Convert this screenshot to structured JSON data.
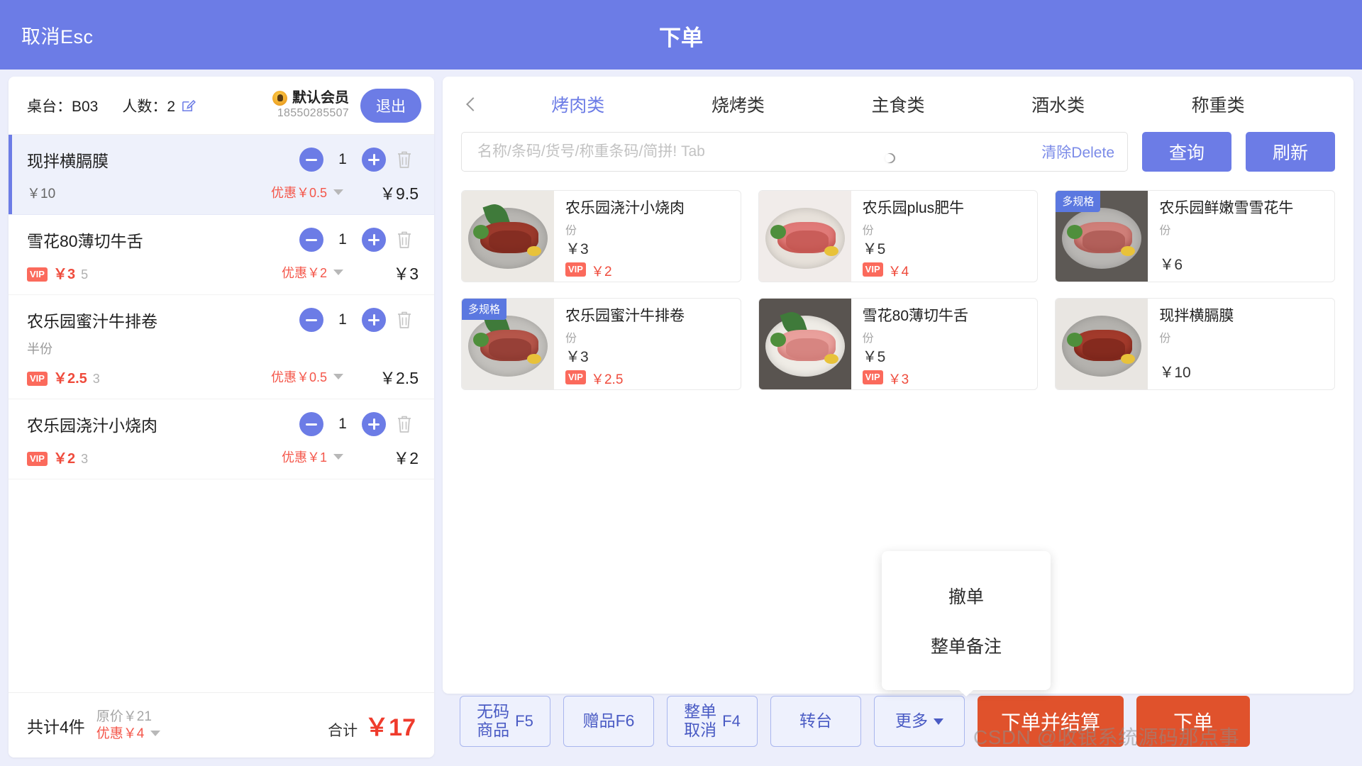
{
  "topbar": {
    "cancel_label": "取消Esc",
    "title": "下单"
  },
  "cart": {
    "table_label": "桌台：B03",
    "people_label": "人数：2",
    "member": {
      "name": "默认会员",
      "phone": "18550285507",
      "logout_label": "退出"
    },
    "items": [
      {
        "name": "现拌横膈膜",
        "spec": "",
        "qty": "1",
        "vip": false,
        "price": "￥10",
        "orig": "",
        "discount": "优惠￥0.5",
        "has_caret": true,
        "total": "￥9.5",
        "active": true
      },
      {
        "name": "雪花80薄切牛舌",
        "spec": "",
        "qty": "1",
        "vip": true,
        "vip_tag": "VIP",
        "price": "￥3",
        "orig": "5",
        "discount": "优惠￥2",
        "has_caret": true,
        "total": "￥3",
        "active": false
      },
      {
        "name": "农乐园蜜汁牛排卷",
        "spec": "半份",
        "qty": "1",
        "vip": true,
        "vip_tag": "VIP",
        "price": "￥2.5",
        "orig": "3",
        "discount": "优惠￥0.5",
        "has_caret": true,
        "total": "￥2.5",
        "active": false
      },
      {
        "name": "农乐园浇汁小烧肉",
        "spec": "",
        "qty": "1",
        "vip": true,
        "vip_tag": "VIP",
        "price": "￥2",
        "orig": "3",
        "discount": "优惠￥1",
        "has_caret": true,
        "total": "￥2",
        "active": false
      }
    ],
    "footer": {
      "count_label": "共计4件",
      "orig_label": "原价￥21",
      "discount_label": "优惠￥4",
      "total_label": "合计",
      "total_value": "￥17"
    }
  },
  "catalog": {
    "categories": [
      {
        "label": "烤肉类",
        "active": true
      },
      {
        "label": "烧烤类",
        "active": false
      },
      {
        "label": "主食类",
        "active": false
      },
      {
        "label": "酒水类",
        "active": false
      },
      {
        "label": "称重类",
        "active": false
      }
    ],
    "search": {
      "placeholder": "名称/条码/货号/称重条码/简拼! Tab",
      "value": "",
      "clear_label": "清除Delete",
      "query_label": "查询",
      "refresh_label": "刷新"
    },
    "products": [
      {
        "name": "农乐园浇汁小烧肉",
        "unit": "份",
        "price": "￥3",
        "vip_tag": "VIP",
        "vip_price": "￥2",
        "badge": "",
        "art": "steak"
      },
      {
        "name": "农乐园plus肥牛",
        "unit": "份",
        "price": "￥5",
        "vip_tag": "VIP",
        "vip_price": "￥4",
        "badge": "",
        "art": "platter"
      },
      {
        "name": "农乐园鲜嫩雪雪花牛",
        "unit": "份",
        "price": "￥6",
        "vip_tag": "",
        "vip_price": "",
        "badge": "多规格",
        "art": "tray"
      },
      {
        "name": "农乐园蜜汁牛排卷",
        "unit": "份",
        "price": "￥3",
        "vip_tag": "VIP",
        "vip_price": "￥2.5",
        "badge": "多规格",
        "art": "rolls"
      },
      {
        "name": "雪花80薄切牛舌",
        "unit": "份",
        "price": "￥5",
        "vip_tag": "VIP",
        "vip_price": "￥3",
        "badge": "",
        "art": "tongue"
      },
      {
        "name": "现拌横膈膜",
        "unit": "份",
        "price": "￥10",
        "vip_tag": "",
        "vip_price": "",
        "badge": "",
        "art": "skirt"
      }
    ]
  },
  "bottombar": {
    "buttons": [
      {
        "line1": "无码",
        "line2": "商品",
        "key": "F5",
        "two_line": true
      },
      {
        "line1": "赠品F6",
        "line2": "",
        "key": "",
        "two_line": false
      },
      {
        "line1": "整单",
        "line2": "取消",
        "key": "F4",
        "two_line": true
      },
      {
        "line1": "转台",
        "line2": "",
        "key": "",
        "two_line": false
      },
      {
        "line1": "更多",
        "line2": "",
        "key": "",
        "two_line": false,
        "caret": true
      }
    ],
    "submit_and_pay_label": "下单并结算",
    "submit_label": "下单"
  },
  "popover": {
    "items": [
      "撤单",
      "整单备注"
    ]
  },
  "watermark": "CSDN @收银系统源码那点事",
  "colors": {
    "brand": "#6c7ce6",
    "accent_red": "#ef3b2c",
    "vip_red": "#fb6a5c",
    "badge_blue": "#5b78e0",
    "submit_orange": "#e0522c"
  }
}
